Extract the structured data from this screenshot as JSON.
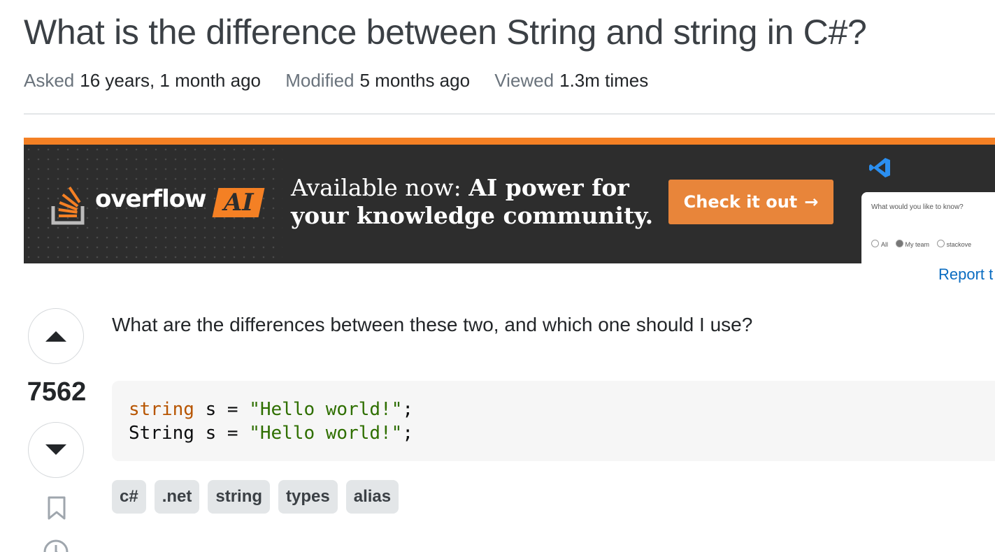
{
  "question": {
    "title": "What is the difference between String and string in C#?",
    "meta": [
      {
        "label": "Asked",
        "value": "16 years, 1 month ago"
      },
      {
        "label": "Modified",
        "value": "5 months ago"
      },
      {
        "label": "Viewed",
        "value": "1.3m times"
      }
    ],
    "body_text": "What are the differences between these two, and which one should I use?",
    "code_lines": [
      {
        "kw": "string",
        "mid": " s = ",
        "str": "\"Hello world!\"",
        "end": ";"
      },
      {
        "kw": "",
        "mid": "String s = ",
        "str": "\"Hello world!\"",
        "end": ";"
      }
    ],
    "tags": [
      "c#",
      ".net",
      "string",
      "types",
      "alias"
    ]
  },
  "vote": {
    "count": "7562",
    "up_icon": "triangle-up-icon",
    "down_icon": "triangle-down-icon"
  },
  "ad": {
    "brand_word": "overflow",
    "brand_ai": "AI",
    "headline_plain": "Available now: ",
    "headline_bold": "AI power for",
    "headline_line2": "your knowledge community.",
    "cta_label": "Check it out",
    "cta_arrow": "→",
    "card_question": "What would you like to know?",
    "card_options": [
      "All",
      "My team",
      "stackove"
    ],
    "accent": "#f48024",
    "background": "#2d2d2d"
  },
  "report_label": "Report t"
}
